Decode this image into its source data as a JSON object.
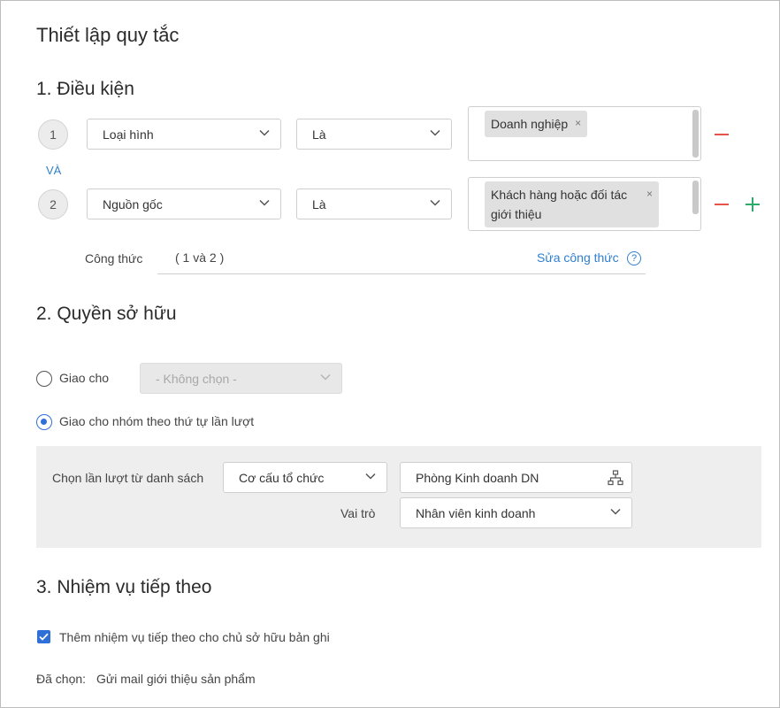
{
  "title": "Thiết lập quy tắc",
  "conditions": {
    "heading": "1. Điều kiện",
    "and_label": "VÀ",
    "rows": [
      {
        "index": "1",
        "field": "Loại hình",
        "operator": "Là",
        "tags": [
          "Doanh nghiệp"
        ]
      },
      {
        "index": "2",
        "field": "Nguồn gốc",
        "operator": "Là",
        "tags": [
          "Khách hàng hoặc đối tác giới thiệu"
        ]
      }
    ],
    "formula_label": "Công thức",
    "formula_value": "( 1 và 2 )",
    "edit_formula": "Sửa công thức",
    "help_glyph": "?"
  },
  "ownership": {
    "heading": "2. Quyền sở hữu",
    "assign_to_label": "Giao cho",
    "assign_to_placeholder": "- Không chọn -",
    "assign_group_label": "Giao cho nhóm theo thứ tự lần lượt",
    "selected_option": "assign_group",
    "pick_from_label": "Chọn lần lượt từ danh sách",
    "pick_from_value": "Cơ cấu tổ chức",
    "department_value": "Phòng Kinh doanh DN",
    "role_label": "Vai trò",
    "role_value": "Nhân viên kinh doanh"
  },
  "next_task": {
    "heading": "3. Nhiệm vụ tiếp theo",
    "checkbox_label": "Thêm nhiệm vụ tiếp theo cho chủ sở hữu bản ghi",
    "checked": true,
    "selected_label": "Đã chọn:",
    "selected_value": "Gửi mail giới thiệu sản phẩm"
  },
  "colors": {
    "accent": "#2f6fd8",
    "link": "#2f7fd0",
    "remove": "#e6554a",
    "add": "#2dab6a"
  },
  "icons": [
    "chevron-down-icon",
    "close-icon",
    "minus-icon",
    "plus-icon",
    "help-icon",
    "org-chart-icon",
    "check-icon"
  ]
}
